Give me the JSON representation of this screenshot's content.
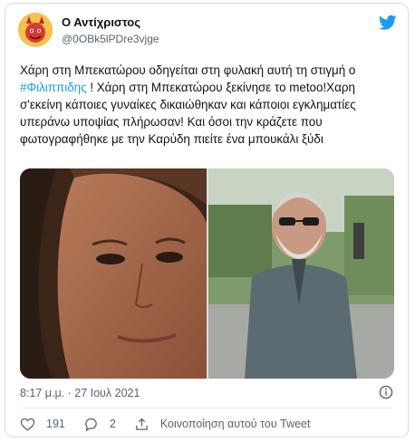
{
  "tweet": {
    "display_name": "Ο Αντίχριστος",
    "handle": "@0OBk5lPDre3vjge",
    "text_before_mention": "Χάρη στη Μπεκατώρου οδηγείται στη φυλακή αυτή τη στιγμή ο ",
    "mention": "#Φιλιππιδης",
    "text_after_mention": " ! Χάρη στη Μπεκατώρου ξεκίνησε το metoo!Χαρη σ'εκείνη κάποιες γυναίκες δικαιώθηκαν και κάποιοι εγκληματίες υπεράνω υποψίας πλήρωσαν! Και όσοι την κράζετε που φωτογραφήθηκε με την Καρύδη πιείτε ένα μπουκάλι ξύδι",
    "timestamp": "8:17 μ.μ. · 27 Ιουλ 2021",
    "likes": "191",
    "replies": "2",
    "share_label": "Κοινοποίηση αυτού του Tweet"
  },
  "colors": {
    "accent": "#1d9bf0",
    "text": "#0f1419",
    "muted": "#536471",
    "border": "#d4dbe1"
  },
  "icons": [
    "avatar-devil",
    "twitter-bird-icon",
    "info-icon",
    "heart-icon",
    "reply-icon",
    "share-icon"
  ]
}
